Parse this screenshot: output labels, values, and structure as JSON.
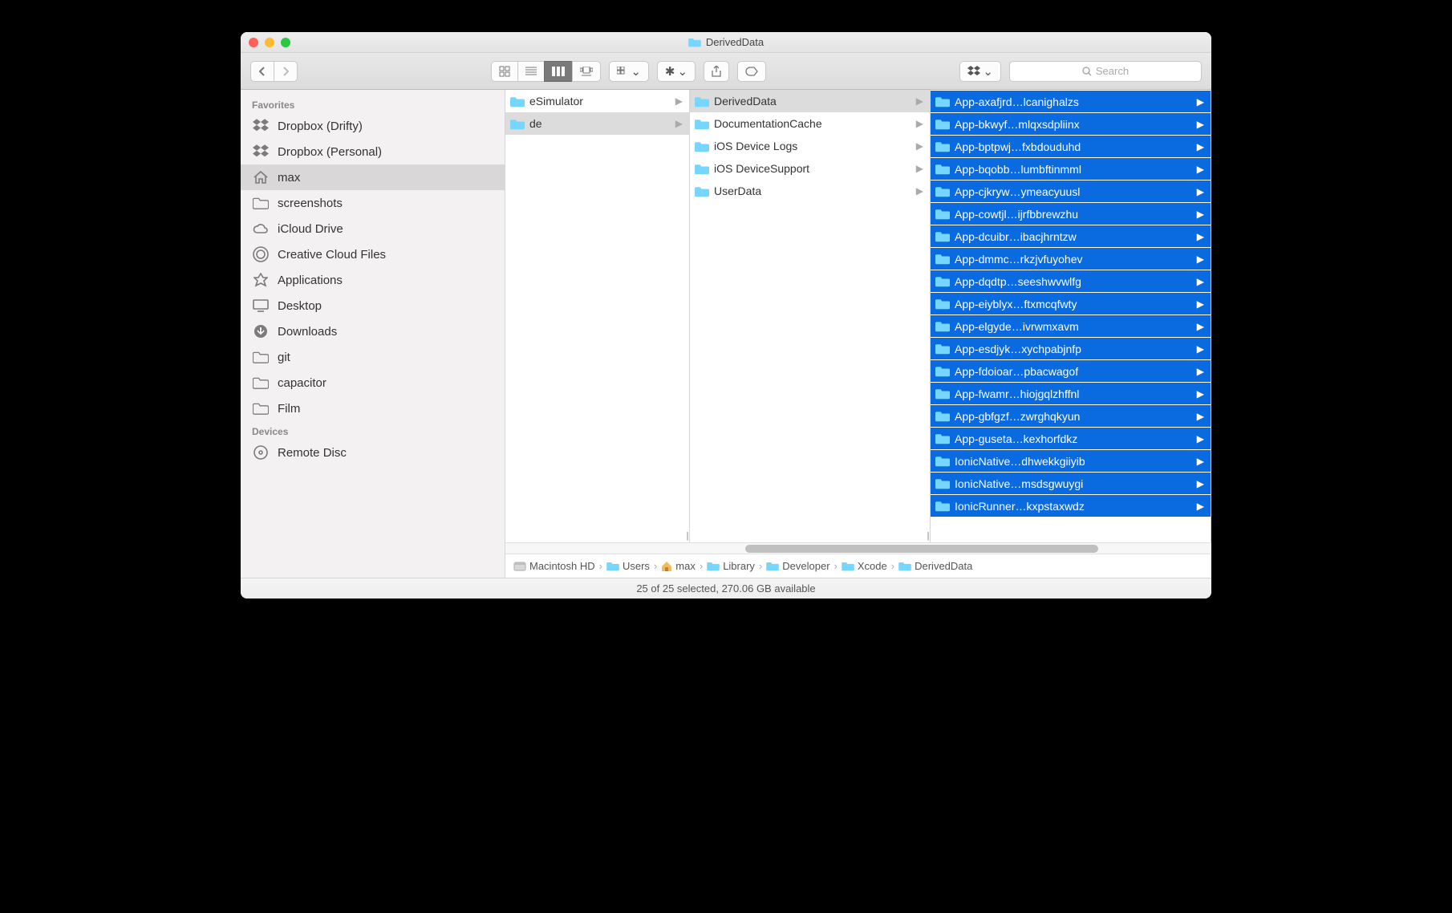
{
  "window": {
    "title": "DerivedData"
  },
  "search": {
    "placeholder": "Search"
  },
  "sidebar": {
    "sections": [
      {
        "title": "Favorites",
        "items": [
          {
            "icon": "dropbox",
            "label": "Dropbox (Drifty)"
          },
          {
            "icon": "dropbox",
            "label": "Dropbox (Personal)"
          },
          {
            "icon": "home",
            "label": "max",
            "selected": true
          },
          {
            "icon": "folder",
            "label": "screenshots"
          },
          {
            "icon": "cloud",
            "label": "iCloud Drive"
          },
          {
            "icon": "cc",
            "label": "Creative Cloud Files"
          },
          {
            "icon": "apps",
            "label": "Applications"
          },
          {
            "icon": "desktop",
            "label": "Desktop"
          },
          {
            "icon": "download",
            "label": "Downloads"
          },
          {
            "icon": "folder",
            "label": "git"
          },
          {
            "icon": "folder",
            "label": "capacitor"
          },
          {
            "icon": "folder",
            "label": "Film"
          }
        ]
      },
      {
        "title": "Devices",
        "items": [
          {
            "icon": "disc",
            "label": "Remote Disc"
          }
        ]
      }
    ]
  },
  "columns": {
    "col1": [
      {
        "label": "eSimulator",
        "arrow": true
      },
      {
        "label": "de",
        "arrow": true,
        "selected": "grey"
      }
    ],
    "col2": [
      {
        "label": "DerivedData",
        "arrow": true,
        "selected": "grey"
      },
      {
        "label": "DocumentationCache",
        "arrow": true
      },
      {
        "label": "iOS Device Logs",
        "arrow": true
      },
      {
        "label": "iOS DeviceSupport",
        "arrow": true
      },
      {
        "label": "UserData",
        "arrow": true
      }
    ],
    "col3": [
      {
        "label": "App-axafjrd…lcanighalzs",
        "arrow": true,
        "selected": "blue"
      },
      {
        "label": "App-bkwyf…mlqxsdpliinx",
        "arrow": true,
        "selected": "blue"
      },
      {
        "label": "App-bptpwj…fxbdouduhd",
        "arrow": true,
        "selected": "blue"
      },
      {
        "label": "App-bqobb…lumbftinmml",
        "arrow": true,
        "selected": "blue"
      },
      {
        "label": "App-cjkryw…ymeacyuusl",
        "arrow": true,
        "selected": "blue"
      },
      {
        "label": "App-cowtjl…ijrfbbrewzhu",
        "arrow": true,
        "selected": "blue"
      },
      {
        "label": "App-dcuibr…ibacjhrntzw",
        "arrow": true,
        "selected": "blue"
      },
      {
        "label": "App-dmmc…rkzjvfuyohev",
        "arrow": true,
        "selected": "blue"
      },
      {
        "label": "App-dqdtp…seeshwvwlfg",
        "arrow": true,
        "selected": "blue"
      },
      {
        "label": "App-eiyblyx…ftxmcqfwty",
        "arrow": true,
        "selected": "blue"
      },
      {
        "label": "App-elgyde…ivrwmxavm",
        "arrow": true,
        "selected": "blue"
      },
      {
        "label": "App-esdjyk…xychpabjnfp",
        "arrow": true,
        "selected": "blue"
      },
      {
        "label": "App-fdoioar…pbacwagof",
        "arrow": true,
        "selected": "blue"
      },
      {
        "label": "App-fwamr…hiojgqlzhffnl",
        "arrow": true,
        "selected": "blue"
      },
      {
        "label": "App-gbfgzf…zwrghqkyun",
        "arrow": true,
        "selected": "blue"
      },
      {
        "label": "App-guseta…kexhorfdkz",
        "arrow": true,
        "selected": "blue"
      },
      {
        "label": "IonicNative…dhwekkgiiyib",
        "arrow": true,
        "selected": "blue"
      },
      {
        "label": "IonicNative…msdsgwuygi",
        "arrow": true,
        "selected": "blue"
      },
      {
        "label": "IonicRunner…kxpstaxwdz",
        "arrow": true,
        "selected": "blue"
      }
    ]
  },
  "pathbar": [
    {
      "icon": "disk",
      "label": "Macintosh HD"
    },
    {
      "icon": "folder",
      "label": "Users"
    },
    {
      "icon": "home",
      "label": "max"
    },
    {
      "icon": "folder",
      "label": "Library"
    },
    {
      "icon": "folder",
      "label": "Developer"
    },
    {
      "icon": "folder",
      "label": "Xcode"
    },
    {
      "icon": "folder",
      "label": "DerivedData"
    }
  ],
  "status": "25 of 25 selected, 270.06 GB available"
}
